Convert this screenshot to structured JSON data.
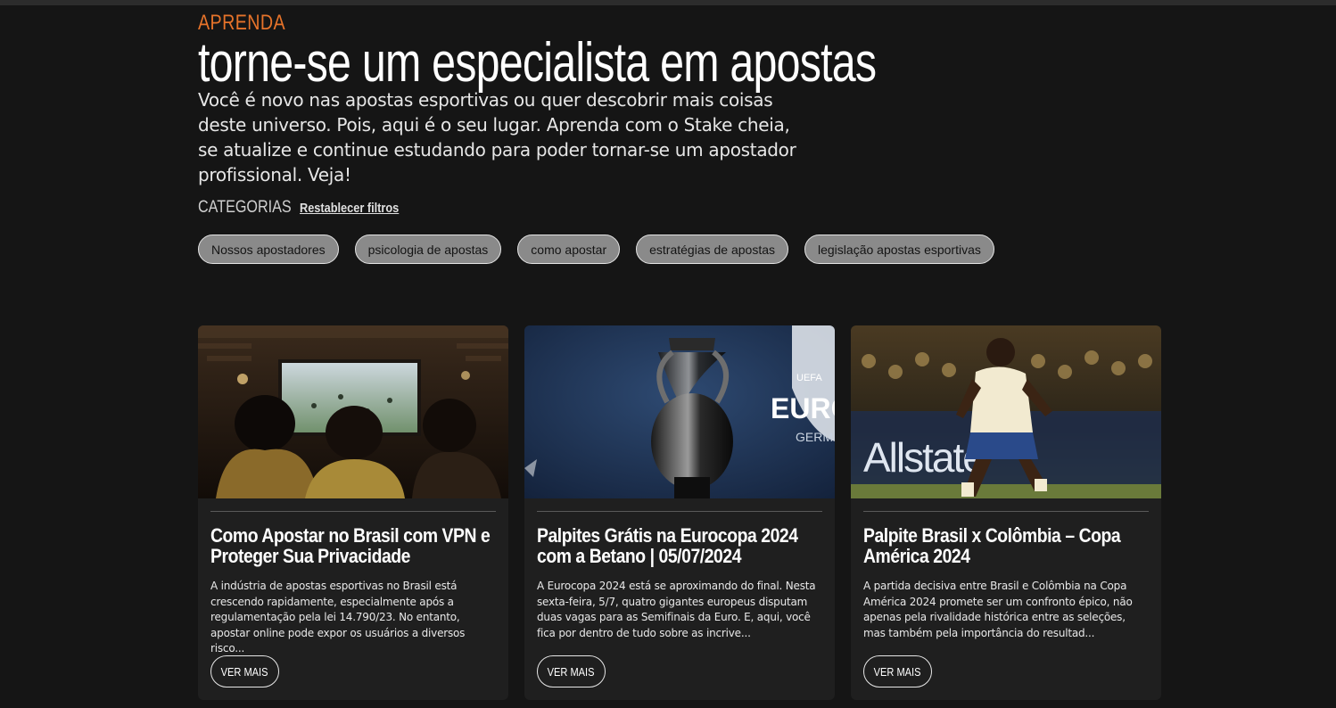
{
  "header": {
    "eyebrow": "APRENDA",
    "title": "torne-se um especialista em apostas",
    "intro": "Você é novo nas apostas esportivas ou quer descobrir mais coisas deste universo. Pois, aqui é o seu lugar. Aprenda com o Stake cheia, se atualize e continue estudando para poder tornar-se um apostador profissional. Veja!"
  },
  "categories": {
    "label": "CATEGORIAS",
    "reset_label": "Restablecer filtros",
    "tags": [
      "Nossos apostadores",
      "psicologia de apostas",
      "como apostar",
      "estratégias de apostas",
      "legislação apostas esportivas"
    ]
  },
  "colors": {
    "accent": "#e6732a",
    "background": "#151515",
    "card": "#1f1f1f"
  },
  "articles": [
    {
      "title": "Como Apostar no Brasil com VPN e Proteger Sua Privacidade",
      "excerpt": "A indústria de apostas esportivas no Brasil está crescendo rapidamente, especialmente após a regulamentação pela lei 14.790/23. No entanto, apostar online pode expor os usuários a diversos risco...",
      "button": "VER MAIS",
      "image_icon": "fans-watching-tv-image"
    },
    {
      "title": "Palpites Grátis na Eurocopa 2024 com a Betano | 05/07/2024",
      "excerpt": "A Eurocopa 2024 está se aproximando do final. Nesta sexta-feira, 5/7, quatro gigantes europeus disputam duas vagas para as Semifinais da Euro. E, aqui, você fica por dentro de tudo sobre as incrive...",
      "button": "VER MAIS",
      "image_icon": "euro-trophy-image",
      "image_text": {
        "uefa": "UEFA",
        "euro": "EURO",
        "germany": "GERM"
      }
    },
    {
      "title": "Palpite Brasil x Colômbia – Copa América 2024",
      "excerpt": "A partida decisiva entre Brasil e Colômbia na Copa América 2024 promete ser um confronto épico, não apenas pela rivalidade histórica entre as seleções, mas também pela importância do resultad...",
      "button": "VER MAIS",
      "image_icon": "football-player-image",
      "image_text": {
        "sponsor": "Allstate"
      }
    }
  ]
}
